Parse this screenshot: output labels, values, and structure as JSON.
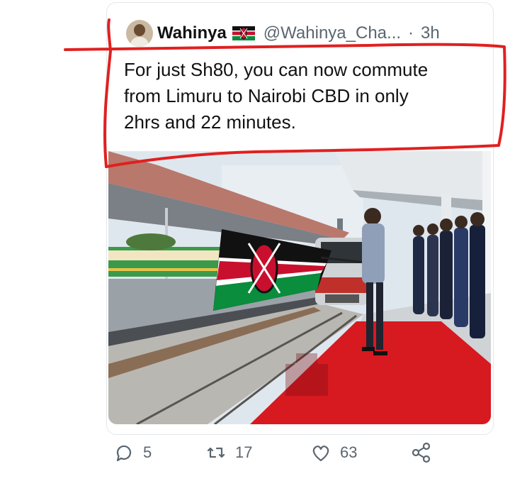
{
  "tweet": {
    "author_name": "Wahinya",
    "handle": "@Wahinya_Cha...",
    "separator": "·",
    "time": "3h",
    "text": "For just Sh80, you can now commute\nfrom Limuru to Nairobi CBD in only\n2hrs and 22 minutes.",
    "flag_icon": "kenya-flag-emoji"
  },
  "actions": {
    "reply_count": "5",
    "retweet_count": "17",
    "like_count": "63"
  },
  "colors": {
    "annotation": "#e02020",
    "icon_gray": "#5b6670",
    "carpet_red": "#d71920",
    "kenya_green": "#0a8d3c"
  },
  "icons": [
    "reply-icon",
    "retweet-icon",
    "like-icon",
    "share-icon"
  ]
}
